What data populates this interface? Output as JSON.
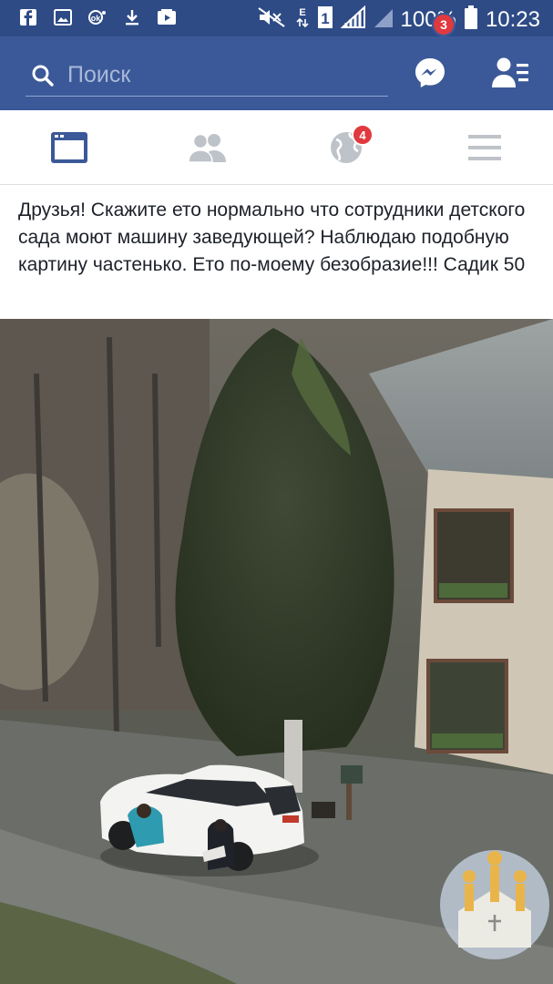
{
  "status_bar": {
    "left_icons": [
      "facebook-icon",
      "gallery-icon",
      "ok-icon",
      "download-icon",
      "youtube-icon"
    ],
    "right_icons": [
      "mute-icon",
      "data-icon",
      "sim-icon",
      "signal-icon",
      "battery-icon"
    ],
    "battery": "100%",
    "time": "10:23"
  },
  "appbar": {
    "search_placeholder": "Поиск",
    "messenger_badge": "3"
  },
  "tabs": {
    "items": [
      "news-feed-icon",
      "friends-requests-icon",
      "notifications-globe-icon",
      "menu-icon"
    ],
    "notifications_badge": "4",
    "active_color": "#3b5998",
    "inactive_color": "#bec3c9"
  },
  "post": {
    "text": "Друзья! Скажите ето нормально что сотрудники детского сада моют машину заведующей? Наблюдаю подобную картину частенько. Ето по-моему безобразие!!! Садик 50"
  },
  "colors": {
    "brand": "#3b5998",
    "statusbar": "#2e4b86",
    "badge": "#e0393e"
  }
}
